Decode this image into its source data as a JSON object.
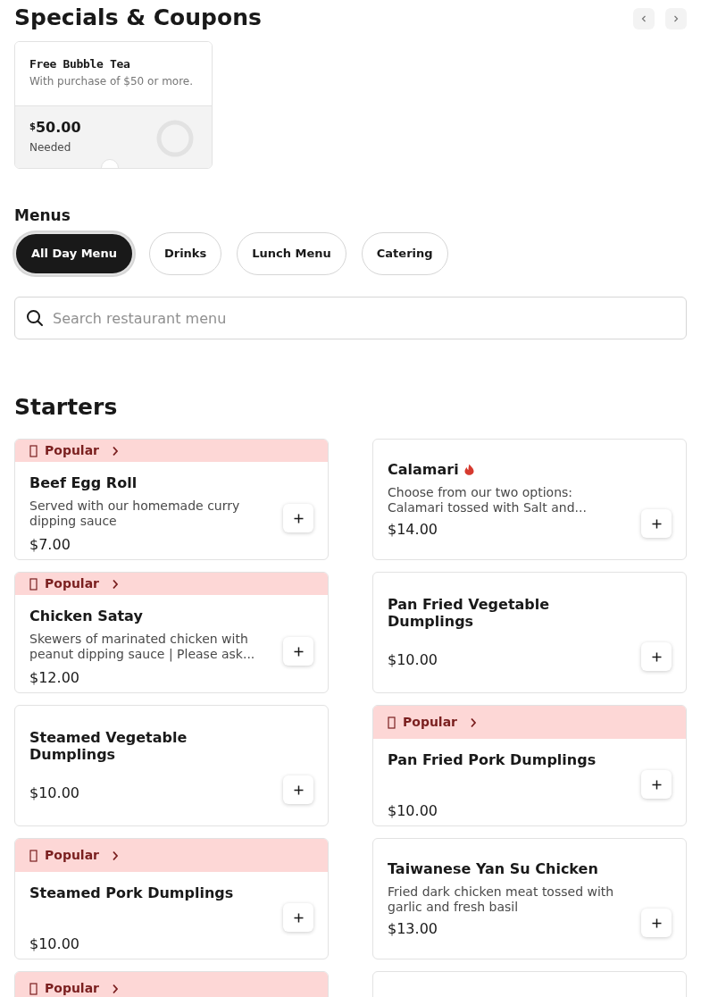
{
  "specials": {
    "title": "Specials & Coupons",
    "coupons": [
      {
        "title": "Free Bubble Tea",
        "subtitle": "With purchase of $50 or more.",
        "currency": "$",
        "amount": "50.00",
        "status": "Needed"
      }
    ]
  },
  "menus": {
    "title": "Menus",
    "tabs": [
      {
        "label": "All Day Menu",
        "selected": true
      },
      {
        "label": "Drinks",
        "selected": false
      },
      {
        "label": "Lunch Menu",
        "selected": false
      },
      {
        "label": "Catering",
        "selected": false
      }
    ]
  },
  "search": {
    "placeholder": "Search restaurant menu"
  },
  "section": {
    "title": "Starters",
    "items": [
      {
        "popular": true,
        "badge": "Popular",
        "name": "Beef Egg Roll",
        "spicy": false,
        "description": "Served with our homemade curry dipping sauce",
        "price": "$7.00"
      },
      {
        "popular": false,
        "name": "Calamari",
        "spicy": true,
        "description": "Choose from our two options: Calamari tossed with Salt and...",
        "price": "$14.00"
      },
      {
        "popular": true,
        "badge": "Popular",
        "name": "Chicken Satay",
        "spicy": false,
        "description": "Skewers of marinated chicken with peanut dipping sauce | Please ask...",
        "price": "$12.00"
      },
      {
        "popular": false,
        "name": "Pan Fried Vegetable Dumplings",
        "spicy": false,
        "price": "$10.00"
      },
      {
        "popular": false,
        "name": "Steamed Vegetable Dumplings",
        "spicy": false,
        "price": "$10.00"
      },
      {
        "popular": true,
        "badge": "Popular",
        "name": "Pan Fried Pork Dumplings",
        "spicy": false,
        "price": "$10.00"
      },
      {
        "popular": true,
        "badge": "Popular",
        "name": "Steamed Pork Dumplings",
        "spicy": false,
        "price": "$10.00"
      },
      {
        "popular": false,
        "name": "Taiwanese Yan Su Chicken",
        "spicy": false,
        "description": "Fried dark chicken meat tossed with garlic and fresh basil",
        "price": "$13.00"
      },
      {
        "popular": true,
        "badge": "Popular"
      },
      {
        "popular": false
      }
    ]
  }
}
